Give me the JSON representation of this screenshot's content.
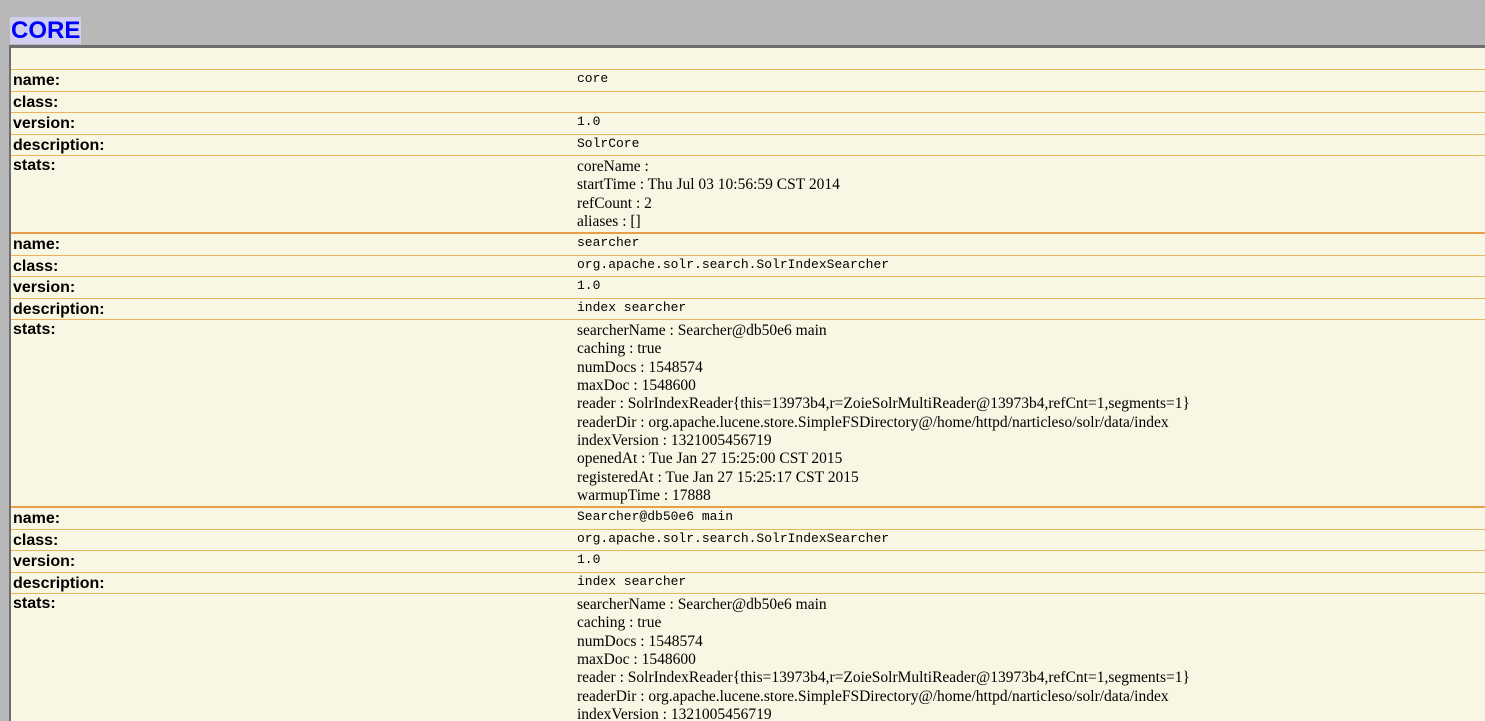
{
  "page": {
    "title": "CORE"
  },
  "entries": [
    {
      "name_label": "name:",
      "name": "core",
      "class_label": "class:",
      "class": "",
      "version_label": "version:",
      "version": "1.0",
      "description_label": "description:",
      "description": "SolrCore",
      "stats_label": "stats:",
      "stats": [
        "coreName :",
        "startTime : Thu Jul 03 10:56:59 CST 2014",
        "refCount : 2",
        "aliases : []"
      ]
    },
    {
      "name_label": "name:",
      "name": "searcher",
      "class_label": "class:",
      "class": "org.apache.solr.search.SolrIndexSearcher",
      "version_label": "version:",
      "version": "1.0",
      "description_label": "description:",
      "description": "index searcher",
      "stats_label": "stats:",
      "stats": [
        "searcherName : Searcher@db50e6 main",
        "caching : true",
        "numDocs : 1548574",
        "maxDoc : 1548600",
        "reader : SolrIndexReader{this=13973b4,r=ZoieSolrMultiReader@13973b4,refCnt=1,segments=1}",
        "readerDir : org.apache.lucene.store.SimpleFSDirectory@/home/httpd/narticleso/solr/data/index",
        "indexVersion : 1321005456719",
        "openedAt : Tue Jan 27 15:25:00 CST 2015",
        "registeredAt : Tue Jan 27 15:25:17 CST 2015",
        "warmupTime : 17888"
      ]
    },
    {
      "name_label": "name:",
      "name": "Searcher@db50e6 main",
      "class_label": "class:",
      "class": "org.apache.solr.search.SolrIndexSearcher",
      "version_label": "version:",
      "version": "1.0",
      "description_label": "description:",
      "description": "index searcher",
      "stats_label": "stats:",
      "stats": [
        "searcherName : Searcher@db50e6 main",
        "caching : true",
        "numDocs : 1548574",
        "maxDoc : 1548600",
        "reader : SolrIndexReader{this=13973b4,r=ZoieSolrMultiReader@13973b4,refCnt=1,segments=1}",
        "readerDir : org.apache.lucene.store.SimpleFSDirectory@/home/httpd/narticleso/solr/data/index",
        "indexVersion : 1321005456719"
      ]
    }
  ]
}
